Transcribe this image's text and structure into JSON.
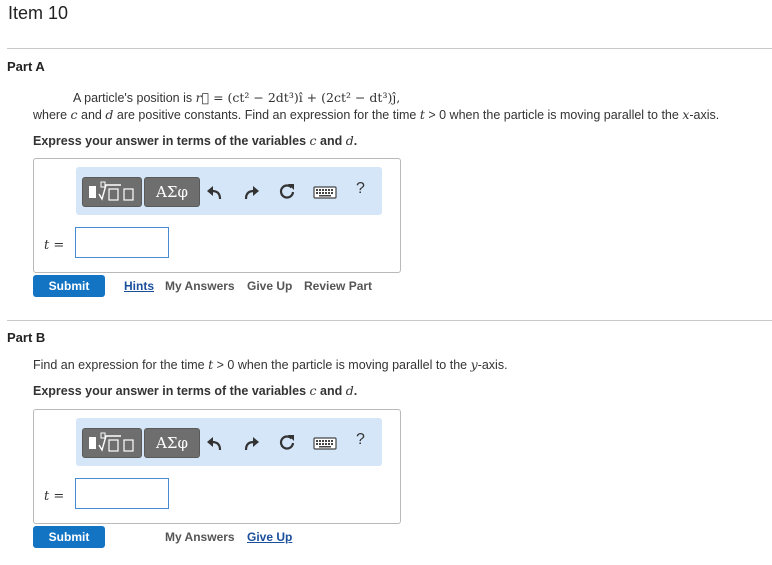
{
  "item_title": "Item 10",
  "part_a": {
    "title": "Part A",
    "q_line1_prefix": "A particle's position is",
    "q_line1_vec": "r⃗",
    "q_line1_eq": " = (ct² − 2dt³)î + (2ct² − dt³)ĵ,",
    "q_line2_where": "where",
    "var_c": "c",
    "q_line2_and": "and",
    "var_d": "d",
    "q_line2_rest": "are positive constants. Find an expression for the time",
    "var_t": "t",
    "q_line2_cond": "> 0 when the particle is moving parallel to the",
    "axis_x": "x",
    "q_line2_end": "-axis.",
    "express_prefix": "Express your answer in terms of the variables",
    "express_c": "c",
    "express_and": "and",
    "express_d": "d",
    "express_end": ".",
    "var_label": "t =",
    "input_value": "",
    "submit_label": "Submit",
    "links": [
      "Hints",
      "My Answers",
      "Give Up",
      "Review Part"
    ]
  },
  "part_b": {
    "title": "Part B",
    "q_prefix": "Find an expression for the time",
    "var_t": "t",
    "q_cond": "> 0 when the particle is moving parallel to the",
    "axis_y": "y",
    "q_end": "-axis.",
    "express_prefix": "Express your answer in terms of the variables",
    "express_c": "c",
    "express_and": "and",
    "express_d": "d",
    "express_end": ".",
    "var_label": "t =",
    "input_value": "",
    "submit_label": "Submit",
    "links": [
      "My Answers",
      "Give Up"
    ]
  },
  "toolbar": {
    "greek_label": "ΑΣφ",
    "help_label": "?",
    "icons": [
      "templates-icon",
      "greek-letters-icon",
      "undo-icon",
      "redo-icon",
      "reset-icon",
      "keyboard-icon",
      "help-icon"
    ]
  },
  "colors": {
    "submit_bg": "#1474c4",
    "toolbar_bg": "#d5e6f8",
    "link_blue": "#1a4f9c",
    "button_gray": "#6e6e6e"
  }
}
